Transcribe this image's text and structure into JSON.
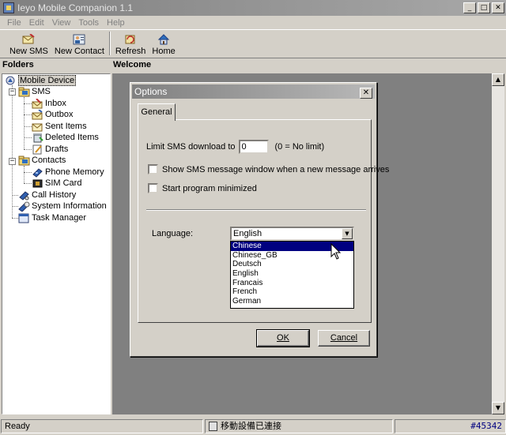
{
  "window": {
    "title": "Ieyo Mobile Companion 1.1",
    "buttons": {
      "minimize": "_",
      "maximize": "□",
      "close": "✕"
    }
  },
  "menu": [
    "File",
    "Edit",
    "View",
    "Tools",
    "Help"
  ],
  "toolbar": {
    "new_sms": "New SMS",
    "new_contact": "New Contact",
    "refresh": "Refresh",
    "home": "Home"
  },
  "panes": {
    "folders_title": "Folders",
    "welcome_title": "Welcome"
  },
  "tree": {
    "mobile_device": "Mobile Device",
    "sms": "SMS",
    "inbox": "Inbox",
    "outbox": "Outbox",
    "sent_items": "Sent Items",
    "deleted_items": "Deleted Items",
    "drafts": "Drafts",
    "contacts": "Contacts",
    "phone_memory": "Phone Memory",
    "sim_card": "SIM Card",
    "call_history": "Call History",
    "system_information": "System Information",
    "task_manager": "Task Manager"
  },
  "status": {
    "ready": "Ready",
    "connection": "移動設備已連接",
    "id": "#45342"
  },
  "dialog": {
    "title": "Options",
    "tab": "General",
    "limit_label": "Limit SMS download to",
    "limit_value": "0",
    "limit_hint": "(0 = No limit)",
    "show_sms_window": "Show SMS message window when a new message arrives",
    "start_minimized": "Start program minimized",
    "language_label": "Language:",
    "language_selected": "English",
    "language_options": [
      "Chinese",
      "Chinese_GB",
      "Deutsch",
      "English",
      "Francais",
      "French",
      "German"
    ],
    "ok_label": "OK",
    "cancel_label": "Cancel"
  }
}
